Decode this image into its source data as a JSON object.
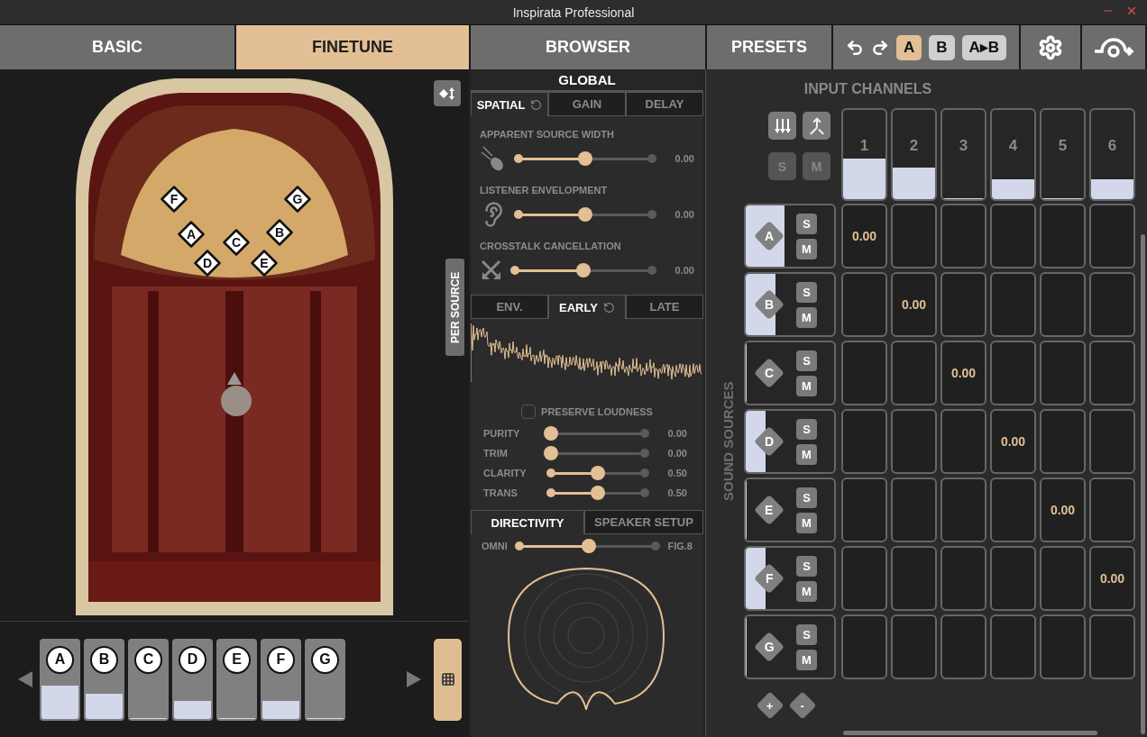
{
  "window": {
    "title": "Inspirata Professional"
  },
  "nav_tabs": [
    {
      "label": "BASIC",
      "selected": false
    },
    {
      "label": "FINETUNE",
      "selected": true
    },
    {
      "label": "BROWSER",
      "selected": false
    },
    {
      "label": "PRESETS",
      "selected": false
    }
  ],
  "compare": [
    {
      "label": "A",
      "selected": true
    },
    {
      "label": "B",
      "selected": false
    },
    {
      "label": "A▸B",
      "selected": false
    }
  ],
  "hall": {
    "side_tab": "PER SOURCE",
    "markers": [
      {
        "label": "F"
      },
      {
        "label": "G"
      },
      {
        "label": "A"
      },
      {
        "label": "C"
      },
      {
        "label": "B"
      },
      {
        "label": "D"
      },
      {
        "label": "E"
      }
    ]
  },
  "source_strip": [
    {
      "label": "A",
      "level": 0.42
    },
    {
      "label": "B",
      "level": 0.32
    },
    {
      "label": "C",
      "level": 0
    },
    {
      "label": "D",
      "level": 0.22
    },
    {
      "label": "E",
      "level": 0
    },
    {
      "label": "F",
      "level": 0.22
    },
    {
      "label": "G",
      "level": 0
    }
  ],
  "global": {
    "title": "GLOBAL",
    "tabs": [
      {
        "label": "SPATIAL",
        "selected": true
      },
      {
        "label": "GAIN",
        "selected": false
      },
      {
        "label": "DELAY",
        "selected": false
      }
    ],
    "sliders": [
      {
        "label": "APPARENT SOURCE WIDTH",
        "kind": "width",
        "level": 0.5,
        "reading": "0.00"
      },
      {
        "label": "LISTENER ENVELOPMENT",
        "kind": "envelopment",
        "level": 0.5,
        "reading": "0.00"
      },
      {
        "label": "CROSSTALK CANCELLATION",
        "kind": "crosstalk",
        "level": 0.5,
        "reading": "0.00"
      }
    ]
  },
  "reflections": {
    "tabs": [
      {
        "label": "ENV.",
        "selected": false
      },
      {
        "label": "EARLY",
        "selected": true
      },
      {
        "label": "LATE",
        "selected": false
      }
    ],
    "preserve_loudness": {
      "label": "PRESERVE LOUDNESS",
      "checked": false
    },
    "sliders": [
      {
        "label": "PURITY",
        "level": 0,
        "reading": "0.00"
      },
      {
        "label": "TRIM",
        "level": 0,
        "reading": "0.00"
      },
      {
        "label": "CLARITY",
        "level": 0.5,
        "reading": "0.50"
      },
      {
        "label": "TRANS",
        "level": 0.5,
        "reading": "0.50"
      }
    ]
  },
  "directivity": {
    "tabs": [
      {
        "label": "DIRECTIVITY",
        "selected": true
      },
      {
        "label": "SPEAKER SETUP",
        "selected": false
      }
    ],
    "min_label": "OMNI",
    "max_label": "FIG.8",
    "level": 0.51
  },
  "matrix": {
    "title": "INPUT CHANNELS",
    "side_label": "SOUND SOURCES",
    "solo": "S",
    "mute": "M",
    "add": "+",
    "remove": "-",
    "channels": [
      {
        "label": "1",
        "level": 0.45
      },
      {
        "label": "2",
        "level": 0.35
      },
      {
        "label": "3",
        "level": 0
      },
      {
        "label": "4",
        "level": 0.22
      },
      {
        "label": "5",
        "level": 0
      },
      {
        "label": "6",
        "level": 0.22
      }
    ],
    "sources": [
      {
        "label": "A",
        "level": 0.44,
        "solo": "S",
        "mute": "M",
        "cells": [
          {
            "kind": "value",
            "text": "0.00"
          },
          {
            "kind": "empty"
          },
          {
            "kind": "empty"
          },
          {
            "kind": "empty"
          },
          {
            "kind": "empty"
          },
          {
            "kind": "empty"
          }
        ]
      },
      {
        "label": "B",
        "level": 0.34,
        "solo": "S",
        "mute": "M",
        "cells": [
          {
            "kind": "empty"
          },
          {
            "kind": "value",
            "text": "0.00"
          },
          {
            "kind": "empty"
          },
          {
            "kind": "empty"
          },
          {
            "kind": "empty"
          },
          {
            "kind": "empty"
          }
        ]
      },
      {
        "label": "C",
        "level": 0,
        "solo": "S",
        "mute": "M",
        "cells": [
          {
            "kind": "empty"
          },
          {
            "kind": "empty"
          },
          {
            "kind": "value",
            "text": "0.00"
          },
          {
            "kind": "empty"
          },
          {
            "kind": "empty"
          },
          {
            "kind": "empty"
          }
        ]
      },
      {
        "label": "D",
        "level": 0.22,
        "solo": "S",
        "mute": "M",
        "cells": [
          {
            "kind": "empty"
          },
          {
            "kind": "empty"
          },
          {
            "kind": "empty"
          },
          {
            "kind": "value",
            "text": "0.00"
          },
          {
            "kind": "empty"
          },
          {
            "kind": "empty"
          }
        ]
      },
      {
        "label": "E",
        "level": 0,
        "solo": "S",
        "mute": "M",
        "cells": [
          {
            "kind": "empty"
          },
          {
            "kind": "empty"
          },
          {
            "kind": "empty"
          },
          {
            "kind": "empty"
          },
          {
            "kind": "value",
            "text": "0.00"
          },
          {
            "kind": "empty"
          }
        ]
      },
      {
        "label": "F",
        "level": 0.22,
        "solo": "S",
        "mute": "M",
        "cells": [
          {
            "kind": "empty"
          },
          {
            "kind": "empty"
          },
          {
            "kind": "empty"
          },
          {
            "kind": "empty"
          },
          {
            "kind": "empty"
          },
          {
            "kind": "value",
            "text": "0.00"
          }
        ]
      },
      {
        "label": "G",
        "level": 0,
        "solo": "S",
        "mute": "M",
        "cells": [
          {
            "kind": "empty"
          },
          {
            "kind": "empty"
          },
          {
            "kind": "empty"
          },
          {
            "kind": "empty"
          },
          {
            "kind": "empty"
          },
          {
            "kind": "empty"
          }
        ]
      }
    ]
  }
}
